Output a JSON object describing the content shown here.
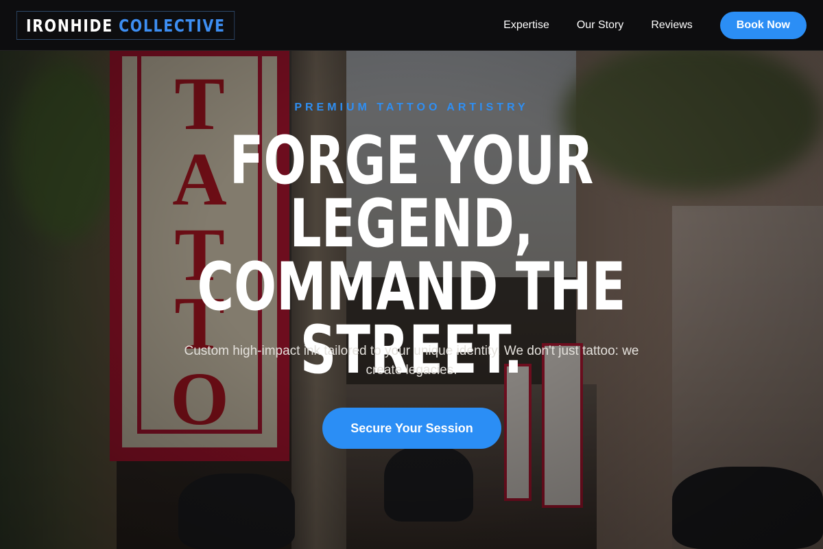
{
  "brand": {
    "name_part1": "IRONHIDE",
    "name_part2": "COLLECTIVE",
    "accent_color": "#2b8ef5"
  },
  "nav": {
    "links": [
      "Expertise",
      "Our Story",
      "Reviews"
    ],
    "cta_label": "Book Now"
  },
  "hero": {
    "eyebrow": "PREMIUM TATTOO ARTISTRY",
    "headline": "FORGE YOUR LEGEND, COMMAND THE STREET.",
    "subtitle": "Custom high-impact ink tailored to your unique identity. We don't just tattoo: we create legacies.",
    "cta_label": "Secure Your Session",
    "background_sign_letters": [
      "T",
      "A",
      "T",
      "T",
      "O"
    ]
  }
}
